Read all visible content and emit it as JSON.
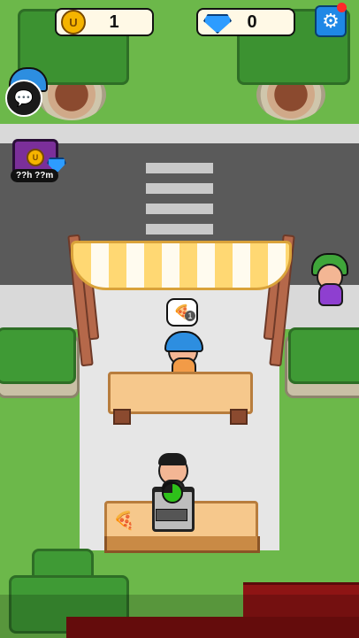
{
  "hud": {
    "coins": {
      "value": "1",
      "icon": "coin-icon",
      "glyph": "U"
    },
    "gems": {
      "value": "0",
      "icon": "gem-icon"
    },
    "settings": {
      "icon": "gear-icon",
      "has_notification": true
    }
  },
  "side_buttons": {
    "chat": {
      "icon": "chat-bubble-icon"
    },
    "chest": {
      "icon": "treasure-chest-icon",
      "timer_label": "??h ??m"
    }
  },
  "customer_order": {
    "item_icon": "pizza-icon",
    "quantity": "1"
  },
  "cook": {
    "progress": 0.75,
    "progress_color": "#2ec11a"
  },
  "counter_item": {
    "icon": "pizza-slice-icon"
  },
  "colors": {
    "grass": "#6cb84a",
    "road": "#5a5a5a",
    "awning_stripe": "#ffd873",
    "table_top": "#f6c88c",
    "customer_hat": "#2d8ee0",
    "npc_hat": "#3fa63a",
    "npc_shirt": "#8e3fd0"
  }
}
